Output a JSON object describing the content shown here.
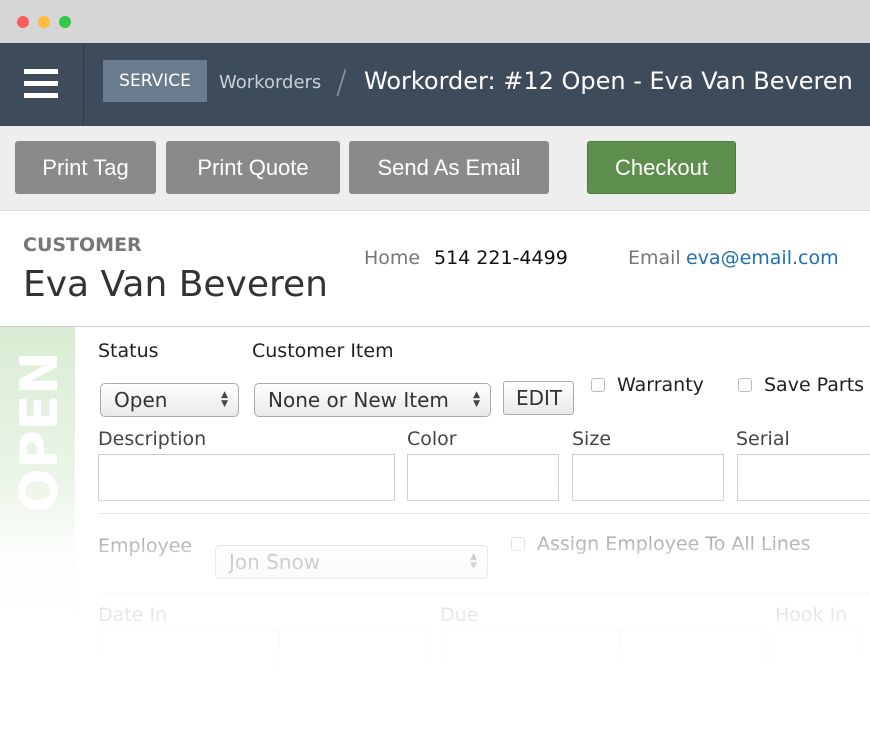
{
  "nav": {
    "section": "SERVICE",
    "breadcrumb": "Workorders",
    "separator": "/",
    "title": "Workorder: #12 Open - Eva Van Beveren"
  },
  "toolbar": {
    "print_tag": "Print Tag",
    "print_quote": "Print Quote",
    "send_email": "Send As Email",
    "checkout": "Checkout"
  },
  "colors": {
    "nav": "#3d4b5a",
    "checkout": "#5e8e4e",
    "button": "#8a8a8a",
    "link": "#1f6fb5"
  },
  "customer": {
    "heading": "CUSTOMER",
    "name": "Eva Van Beveren",
    "home_label": "Home",
    "home": "514 221-4499",
    "email_label": "Email",
    "email": "eva@email.com"
  },
  "status_banner": "OPEN",
  "form": {
    "status_label": "Status",
    "status_value": "Open",
    "item_label": "Customer Item",
    "item_value": "None or New Item",
    "edit": "EDIT",
    "warranty": "Warranty",
    "save_parts": "Save Parts",
    "description": "Description",
    "color": "Color",
    "size": "Size",
    "serial": "Serial",
    "employee": "Employee",
    "employee_value": "Jon Snow",
    "assign_all": "Assign Employee To All Lines",
    "date_in": "Date In",
    "due": "Due",
    "hook_in": "Hook In"
  }
}
